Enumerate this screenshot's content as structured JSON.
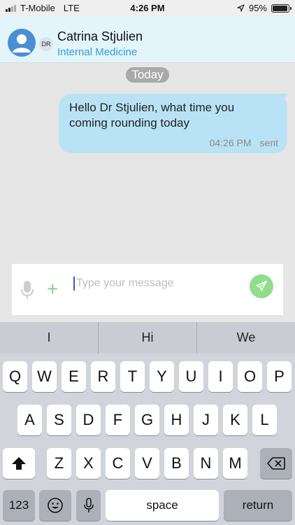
{
  "status_bar": {
    "carrier": "T-Mobile",
    "network": "LTE",
    "time": "4:26 PM",
    "battery": "95%",
    "battery_level": 0.95,
    "icons": [
      "signal-icon",
      "location-arrow-icon",
      "battery-icon"
    ]
  },
  "header": {
    "name": "Catrina Stjulien",
    "department": "Internal Medicine",
    "initials": "DR"
  },
  "chat": {
    "day_label": "Today",
    "messages": [
      {
        "text": "Hello Dr Stjulien, what time you coming rounding today",
        "time": "04:26 PM",
        "status": "sent"
      }
    ]
  },
  "composer": {
    "placeholder": "Type your message",
    "value": "",
    "accent_color": "#90dd8c"
  },
  "keyboard": {
    "suggestions": [
      "I",
      "Hi",
      "We"
    ],
    "row1": [
      "Q",
      "W",
      "E",
      "R",
      "T",
      "Y",
      "U",
      "I",
      "O",
      "P"
    ],
    "row2": [
      "A",
      "S",
      "D",
      "F",
      "G",
      "H",
      "J",
      "K",
      "L"
    ],
    "row3": [
      "Z",
      "X",
      "C",
      "V",
      "B",
      "N",
      "M"
    ],
    "numbers_label": "123",
    "space_label": "space",
    "return_label": "return"
  },
  "colors": {
    "header_bg": "#e3f4fb",
    "department": "#2f9fd8",
    "bubble": "#b9e3f5"
  }
}
